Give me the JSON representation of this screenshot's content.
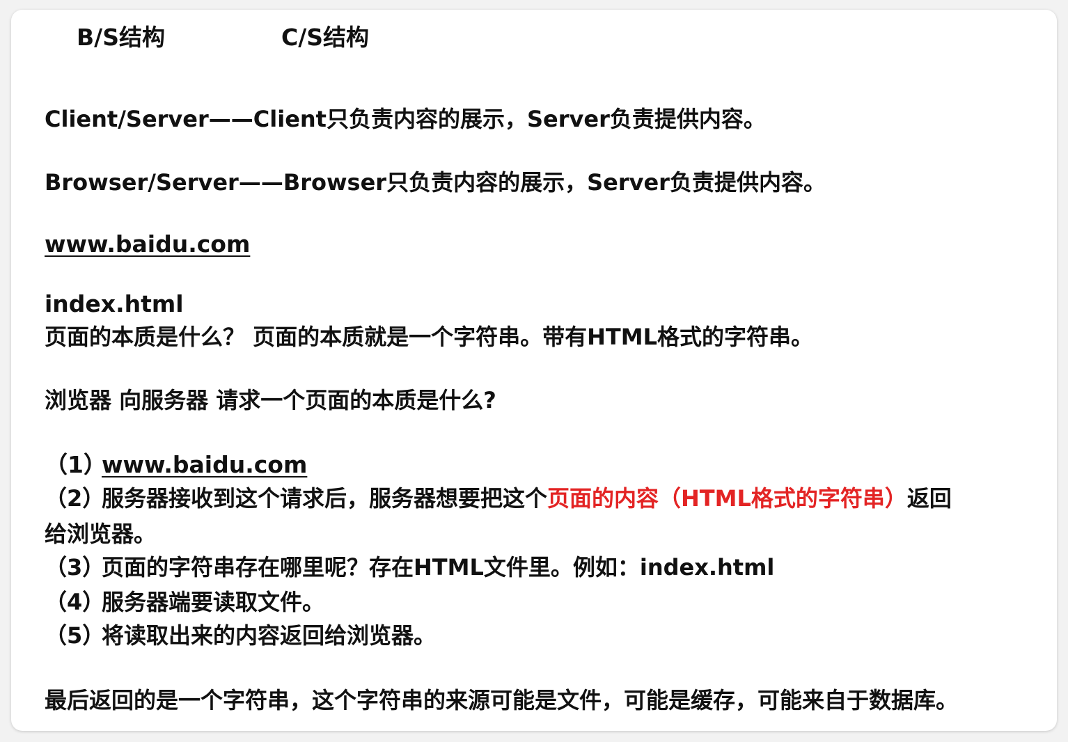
{
  "headings": {
    "bs": "B/S结构",
    "cs": "C/S结构"
  },
  "definitions": {
    "client_server": "Client/Server——Client只负责内容的展示，Server负责提供内容。",
    "browser_server": "Browser/Server——Browser只负责内容的展示，Server负责提供内容。"
  },
  "link": "www.baidu.com",
  "file_name": "index.html",
  "question_answer": "页面的本质是什么？  页面的本质就是一个字符串。带有HTML格式的字符串。",
  "question2": "浏览器 向服务器 请求一个页面的本质是什么?",
  "steps": {
    "s1_num": "（1）",
    "s1_link": "www.baidu.com",
    "s2_num": "（2）",
    "s2_a": "服务器接收到这个请求后，服务器想要把这个",
    "s2_red": "页面的内容（HTML格式的字符串）",
    "s2_b": "返回",
    "s2_cont": "给浏览器。",
    "s3_num": "（3）",
    "s3_text": "页面的字符串存在哪里呢？存在HTML文件里。例如：index.html",
    "s4_num": "（4）",
    "s4_text": "服务器端要读取文件。",
    "s5_num": "（5）",
    "s5_text": "将读取出来的内容返回给浏览器。"
  },
  "conclusion": "最后返回的是一个字符串，这个字符串的来源可能是文件，可能是缓存，可能来自于数据库。",
  "colors": {
    "text": "#111111",
    "highlight": "#e32424",
    "card": "#ffffff"
  }
}
